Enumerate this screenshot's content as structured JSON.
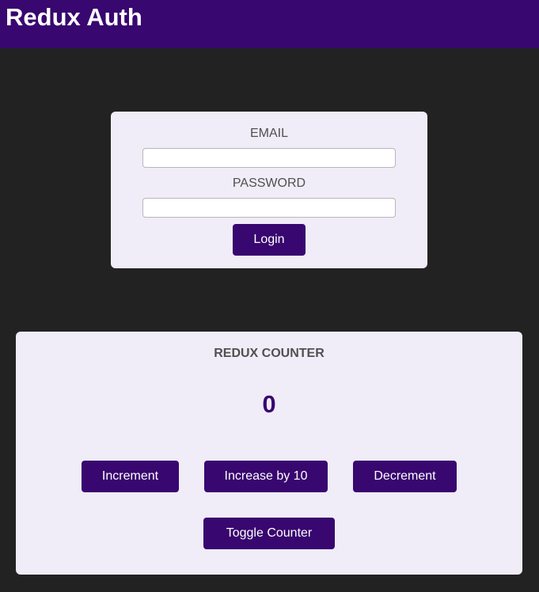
{
  "header": {
    "title": "Redux Auth"
  },
  "auth": {
    "email_label": "EMAIL",
    "email_value": "",
    "password_label": "PASSWORD",
    "password_value": "",
    "login_label": "Login"
  },
  "counter": {
    "heading": "REDUX COUNTER",
    "value": "0",
    "increment_label": "Increment",
    "increase_label": "Increase by 10",
    "decrement_label": "Decrement",
    "toggle_label": "Toggle Counter"
  },
  "colors": {
    "brand": "#38076f",
    "background": "#222222",
    "card": "#f0ecf8"
  }
}
